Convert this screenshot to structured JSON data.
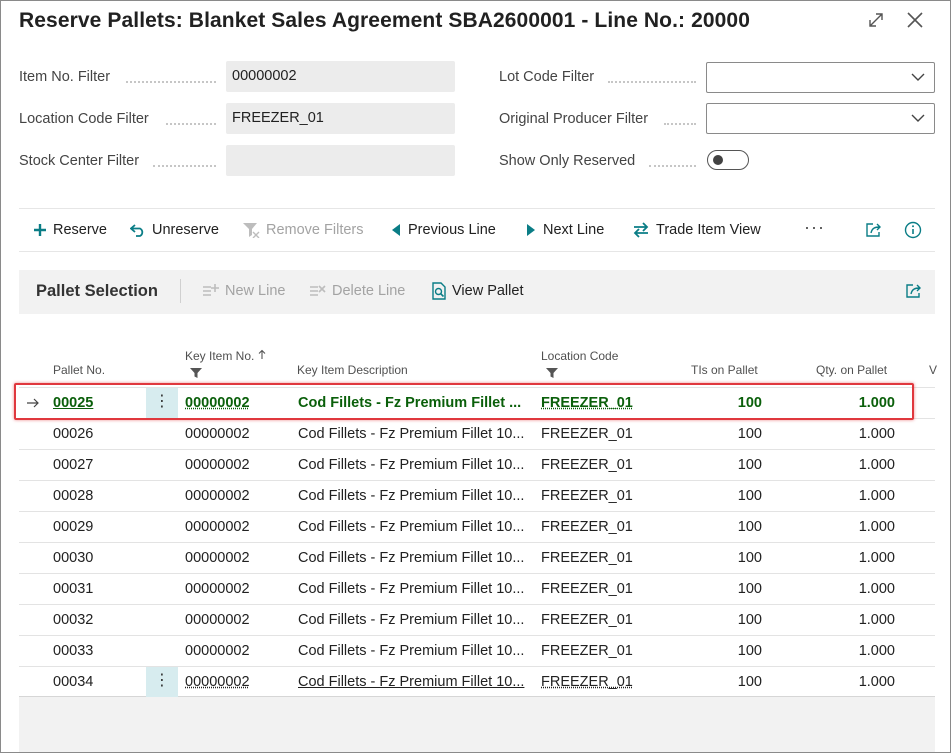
{
  "window": {
    "title": "Reserve Pallets: Blanket Sales Agreement SBA2600001 - Line No.: 20000"
  },
  "filters": {
    "item_no": {
      "label": "Item No. Filter",
      "value": "00000002"
    },
    "location_code": {
      "label": "Location Code Filter",
      "value": "FREEZER_01"
    },
    "stock_center": {
      "label": "Stock Center Filter",
      "value": ""
    },
    "lot_code": {
      "label": "Lot Code Filter",
      "value": ""
    },
    "original_producer": {
      "label": "Original Producer Filter",
      "value": ""
    },
    "show_only_reserved": {
      "label": "Show Only Reserved",
      "value": "off"
    }
  },
  "actions": {
    "reserve": "Reserve",
    "unreserve": "Unreserve",
    "remove_filters": "Remove Filters",
    "previous_line": "Previous Line",
    "next_line": "Next Line",
    "trade_item_view": "Trade Item View",
    "more": "···"
  },
  "part": {
    "title": "Pallet Selection",
    "new_line": "New Line",
    "delete_line": "Delete Line",
    "view_pallet": "View Pallet"
  },
  "columns": {
    "pallet_no": "Pallet No.",
    "key_item_no": "Key Item No.",
    "key_item_desc": "Key Item Description",
    "location_code": "Location Code",
    "tis_on_pallet": "TIs on Pallet",
    "qty_on_pallet": "Qty. on Pallet",
    "next_col": "V"
  },
  "rows": [
    {
      "pallet": "00025",
      "item": "00000002",
      "desc": "Cod Fillets - Fz Premium Fillet ...",
      "loc": "FREEZER_01",
      "tis": "100",
      "qty": "1.000"
    },
    {
      "pallet": "00026",
      "item": "00000002",
      "desc": "Cod Fillets - Fz Premium Fillet 10...",
      "loc": "FREEZER_01",
      "tis": "100",
      "qty": "1.000"
    },
    {
      "pallet": "00027",
      "item": "00000002",
      "desc": "Cod Fillets - Fz Premium Fillet 10...",
      "loc": "FREEZER_01",
      "tis": "100",
      "qty": "1.000"
    },
    {
      "pallet": "00028",
      "item": "00000002",
      "desc": "Cod Fillets - Fz Premium Fillet 10...",
      "loc": "FREEZER_01",
      "tis": "100",
      "qty": "1.000"
    },
    {
      "pallet": "00029",
      "item": "00000002",
      "desc": "Cod Fillets - Fz Premium Fillet 10...",
      "loc": "FREEZER_01",
      "tis": "100",
      "qty": "1.000"
    },
    {
      "pallet": "00030",
      "item": "00000002",
      "desc": "Cod Fillets - Fz Premium Fillet 10...",
      "loc": "FREEZER_01",
      "tis": "100",
      "qty": "1.000"
    },
    {
      "pallet": "00031",
      "item": "00000002",
      "desc": "Cod Fillets - Fz Premium Fillet 10...",
      "loc": "FREEZER_01",
      "tis": "100",
      "qty": "1.000"
    },
    {
      "pallet": "00032",
      "item": "00000002",
      "desc": "Cod Fillets - Fz Premium Fillet 10...",
      "loc": "FREEZER_01",
      "tis": "100",
      "qty": "1.000"
    },
    {
      "pallet": "00033",
      "item": "00000002",
      "desc": "Cod Fillets - Fz Premium Fillet 10...",
      "loc": "FREEZER_01",
      "tis": "100",
      "qty": "1.000"
    },
    {
      "pallet": "00034",
      "item": "00000002",
      "desc": "Cod Fillets - Fz Premium Fillet 10...",
      "loc": "FREEZER_01",
      "tis": "100",
      "qty": "1.000"
    }
  ],
  "colors": {
    "accent": "#0a7d86",
    "selected_text": "#0a5f0a",
    "highlight_border": "#e0383e",
    "row_menu_bg": "#d7ecef"
  },
  "icons": {
    "expand": "expand-icon",
    "close": "close-icon",
    "chevron": "chevron-down-icon",
    "reserve": "plus-icon",
    "unreserve": "undo-icon",
    "remove_filters": "filter-clear-icon",
    "previous_line": "triangle-left-icon",
    "next_line": "triangle-right-icon",
    "trade_item_view": "swap-arrows-icon",
    "share": "share-icon",
    "info": "info-icon",
    "view_pallet": "document-search-icon",
    "row_arrow": "arrow-right-icon"
  }
}
